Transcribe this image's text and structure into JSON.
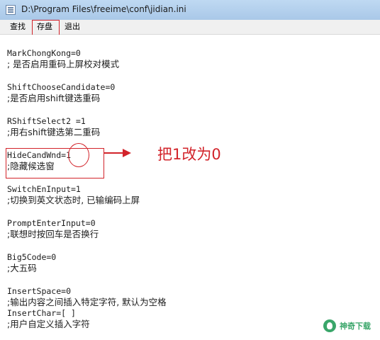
{
  "window": {
    "title": "D:\\Program Files\\freeime\\conf\\jidian.ini",
    "icon": "notepad-icon"
  },
  "menu": {
    "items": [
      "查找",
      "存盘",
      "退出"
    ]
  },
  "editor": {
    "lines": [
      "MarkChongKong=0",
      "; 是否启用重码上屏校对模式",
      "ShiftChooseCandidate=0",
      ";是否启用shift键选重码",
      "RShiftSelect2 =1",
      ";用右shift键选第二重码",
      "HideCandWnd=1",
      ";隐藏候选窗",
      "SwitchEnInput=1",
      ";切换到英文状态时, 已输编码上屏",
      "PromptEnterInput=0",
      ";联想时按回车是否换行",
      "Big5Code=0",
      ";大五码",
      "InsertSpace=0",
      ";输出内容之间插入特定字符, 默认为空格",
      "InsertChar=[ ]",
      ";用户自定义插入字符"
    ]
  },
  "annotation": {
    "text": "把1改为0",
    "color": "#d2232a"
  },
  "watermark": {
    "text": "神奇下载",
    "color": "#3aa66a"
  }
}
